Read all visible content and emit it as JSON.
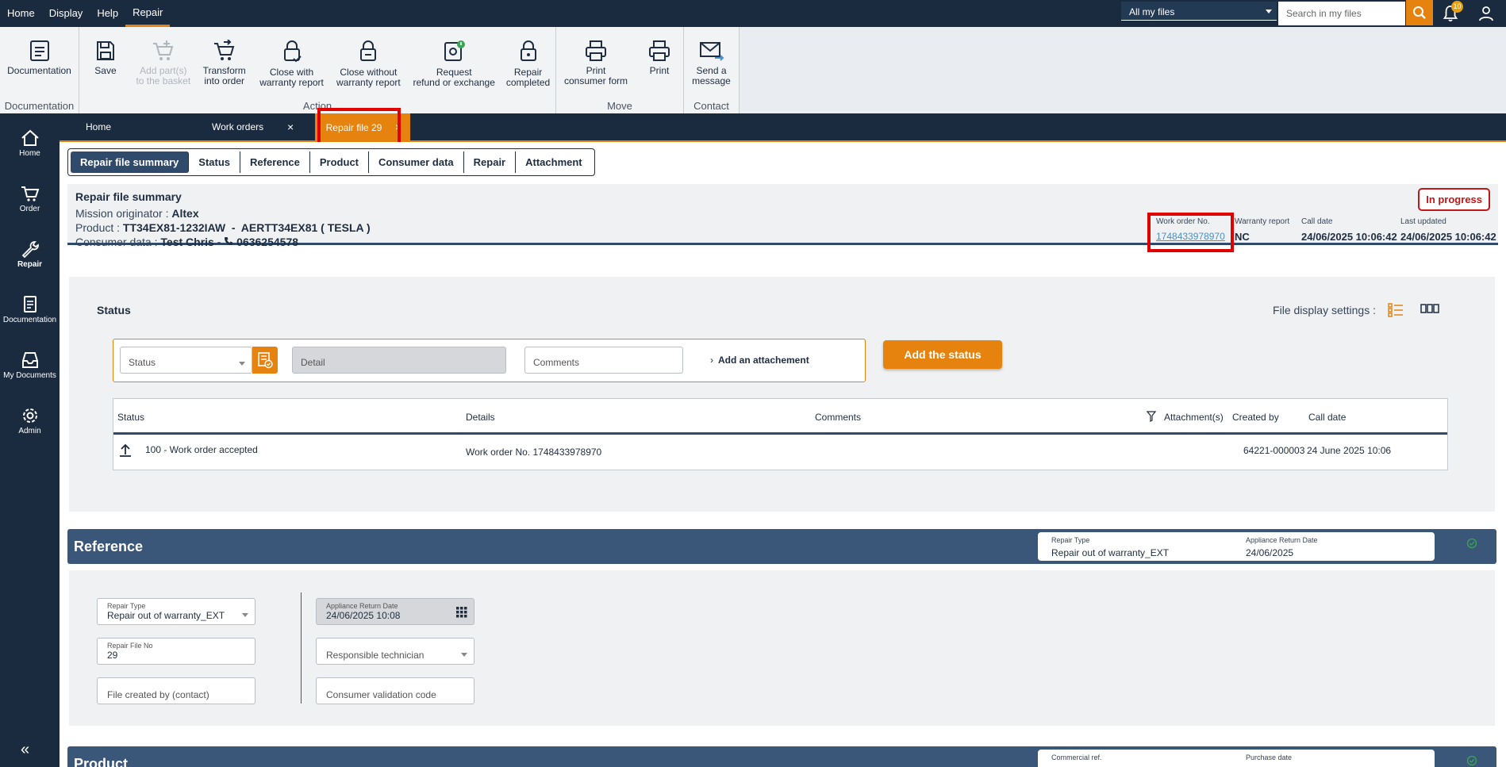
{
  "menu": {
    "items": [
      "Home",
      "Display",
      "Help",
      "Repair"
    ],
    "active": "Repair"
  },
  "search": {
    "scope": "All my files",
    "placeholder": "Search in my files"
  },
  "notifications": {
    "count": "10"
  },
  "ribbon": {
    "documentation": {
      "label": "Documentation",
      "group": "Documentation"
    },
    "action": {
      "group": "Action",
      "save": "Save",
      "add_parts": [
        "Add part(s)",
        "to the basket"
      ],
      "transform": [
        "Transform",
        "into order"
      ],
      "close_with": [
        "Close with",
        "warranty report"
      ],
      "close_without": [
        "Close without",
        "warranty report"
      ],
      "request": [
        "Request",
        "refund or exchange"
      ],
      "completed": [
        "Repair",
        "completed"
      ]
    },
    "move": {
      "group": "Move",
      "print_consumer": [
        "Print",
        "consumer form"
      ],
      "print": "Print"
    },
    "contact": {
      "group": "Contact",
      "send": [
        "Send a",
        "message"
      ]
    }
  },
  "nav": {
    "home": "Home",
    "order": "Order",
    "repair": "Repair",
    "documentation": "Documentation",
    "my_documents": "My Documents",
    "admin": "Admin"
  },
  "tabs": {
    "home": "Home",
    "work_orders": "Work orders",
    "repair_file": "Repair file 29",
    "close": "×"
  },
  "subtabs": [
    "Repair file summary",
    "Status",
    "Reference",
    "Product",
    "Consumer data",
    "Repair",
    "Attachment"
  ],
  "summary": {
    "title": "Repair file summary",
    "mission_label": "Mission originator : ",
    "mission_value": "Altex",
    "product_label": "Product : ",
    "product_value": "TT34EX81-1232IAW  -  AERTT34EX81 ( TESLA )",
    "consumer_label": "Consumer data : ",
    "consumer_name": "Test Chris - ",
    "consumer_phone": "0636254578",
    "badge": "In progress",
    "work_order_label": "Work order No.",
    "work_order_value": "1748433978970",
    "warranty_label": "Warranty report",
    "warranty_value": "NC",
    "call_date_label": "Call date",
    "call_date_value": "24/06/2025 10:06:42",
    "last_updated_label": "Last updated",
    "last_updated_value": "24/06/2025 10:06:42"
  },
  "status_panel": {
    "title": "Status",
    "display_settings": "File display settings :",
    "status_placeholder": "Status",
    "detail_placeholder": "Detail",
    "comments_placeholder": "Comments",
    "attach": "Add an attachement",
    "add_button": "Add the status",
    "columns": [
      "Status",
      "Details",
      "Comments",
      "Attachment(s)",
      "Created by",
      "Call date"
    ],
    "row": {
      "status": "100 - Work order accepted",
      "details": "Work order No. 1748433978970",
      "created_by": "64221-000003",
      "call_date": "24 June 2025 10:06"
    }
  },
  "reference": {
    "title": "Reference",
    "card": {
      "k1": "Repair Type",
      "v1": "Repair out of warranty_EXT",
      "k2": "Appliance Return Date",
      "v2": "24/06/2025"
    },
    "repair_type_label": "Repair Type",
    "repair_type_value": "Repair out of warranty_EXT",
    "repair_file_label": "Repair File No",
    "repair_file_value": "29",
    "created_by_placeholder": "File created by (contact)",
    "return_date_label": "Appliance Return Date",
    "return_date_value": "24/06/2025 10:08",
    "technician_placeholder": "Responsible technician",
    "validation_placeholder": "Consumer validation code"
  },
  "product": {
    "title": "Product",
    "card": {
      "k1": "Commercial ref.",
      "k2": "Purchase date"
    }
  }
}
